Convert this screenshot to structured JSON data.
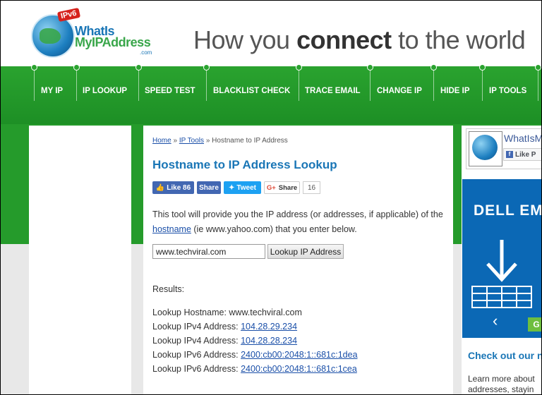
{
  "header": {
    "logo_badge": "IPv6",
    "logo_line1": "WhatIs",
    "logo_line2": "MyIPAddress",
    "logo_com": ".com",
    "tagline_pre": "How you ",
    "tagline_bold": "connect",
    "tagline_post": " to the world"
  },
  "nav": {
    "items": [
      {
        "label": "MY IP"
      },
      {
        "label": "IP LOOKUP"
      },
      {
        "label": "SPEED TEST"
      },
      {
        "label": "BLACKLIST CHECK"
      },
      {
        "label": "TRACE EMAIL"
      },
      {
        "label": "CHANGE IP"
      },
      {
        "label": "HIDE IP"
      },
      {
        "label": "IP TOOLS"
      }
    ]
  },
  "breadcrumb": {
    "home": "Home",
    "sep1": "»",
    "ip_tools": "IP Tools",
    "sep2": "»",
    "current": "Hostname to IP Address"
  },
  "page": {
    "title": "Hostname to IP Address Lookup"
  },
  "social": {
    "like_label": "Like 86",
    "share_label": "Share",
    "tweet_label": "Tweet",
    "gshare_label": "Share",
    "gshare_count": "16"
  },
  "intro": {
    "text_pre": "This tool will provide you the IP address (or addresses, if applicable) of the ",
    "link": "hostname",
    "text_post": " (ie www.yahoo.com) that you enter below."
  },
  "form": {
    "hostname_value": "www.techviral.com",
    "button_label": "Lookup IP Address"
  },
  "results": {
    "label": "Results:",
    "hostname_label": "Lookup Hostname: www.techviral.com",
    "lines": [
      {
        "label": "Lookup IPv4 Address: ",
        "value": "104.28.29.234"
      },
      {
        "label": "Lookup IPv4 Address: ",
        "value": "104.28.28.234"
      },
      {
        "label": "Lookup IPv6 Address: ",
        "value": "2400:cb00:2048:1::681c:1dea"
      },
      {
        "label": "Lookup IPv6 Address: ",
        "value": "2400:cb00:2048:1::681c:1cea"
      }
    ]
  },
  "sidebar": {
    "fb_name": "WhatIsM",
    "fb_like": "Like P",
    "ad_logo": "DELL EM",
    "ad_go": "G",
    "checkout": "Check out our n",
    "learn_more_line1": "Learn more about",
    "learn_more_line2": "addresses, stayin"
  },
  "colors": {
    "brand_green": "#2aa32f",
    "brand_blue": "#1a76b6",
    "link": "#1a4fa8"
  }
}
